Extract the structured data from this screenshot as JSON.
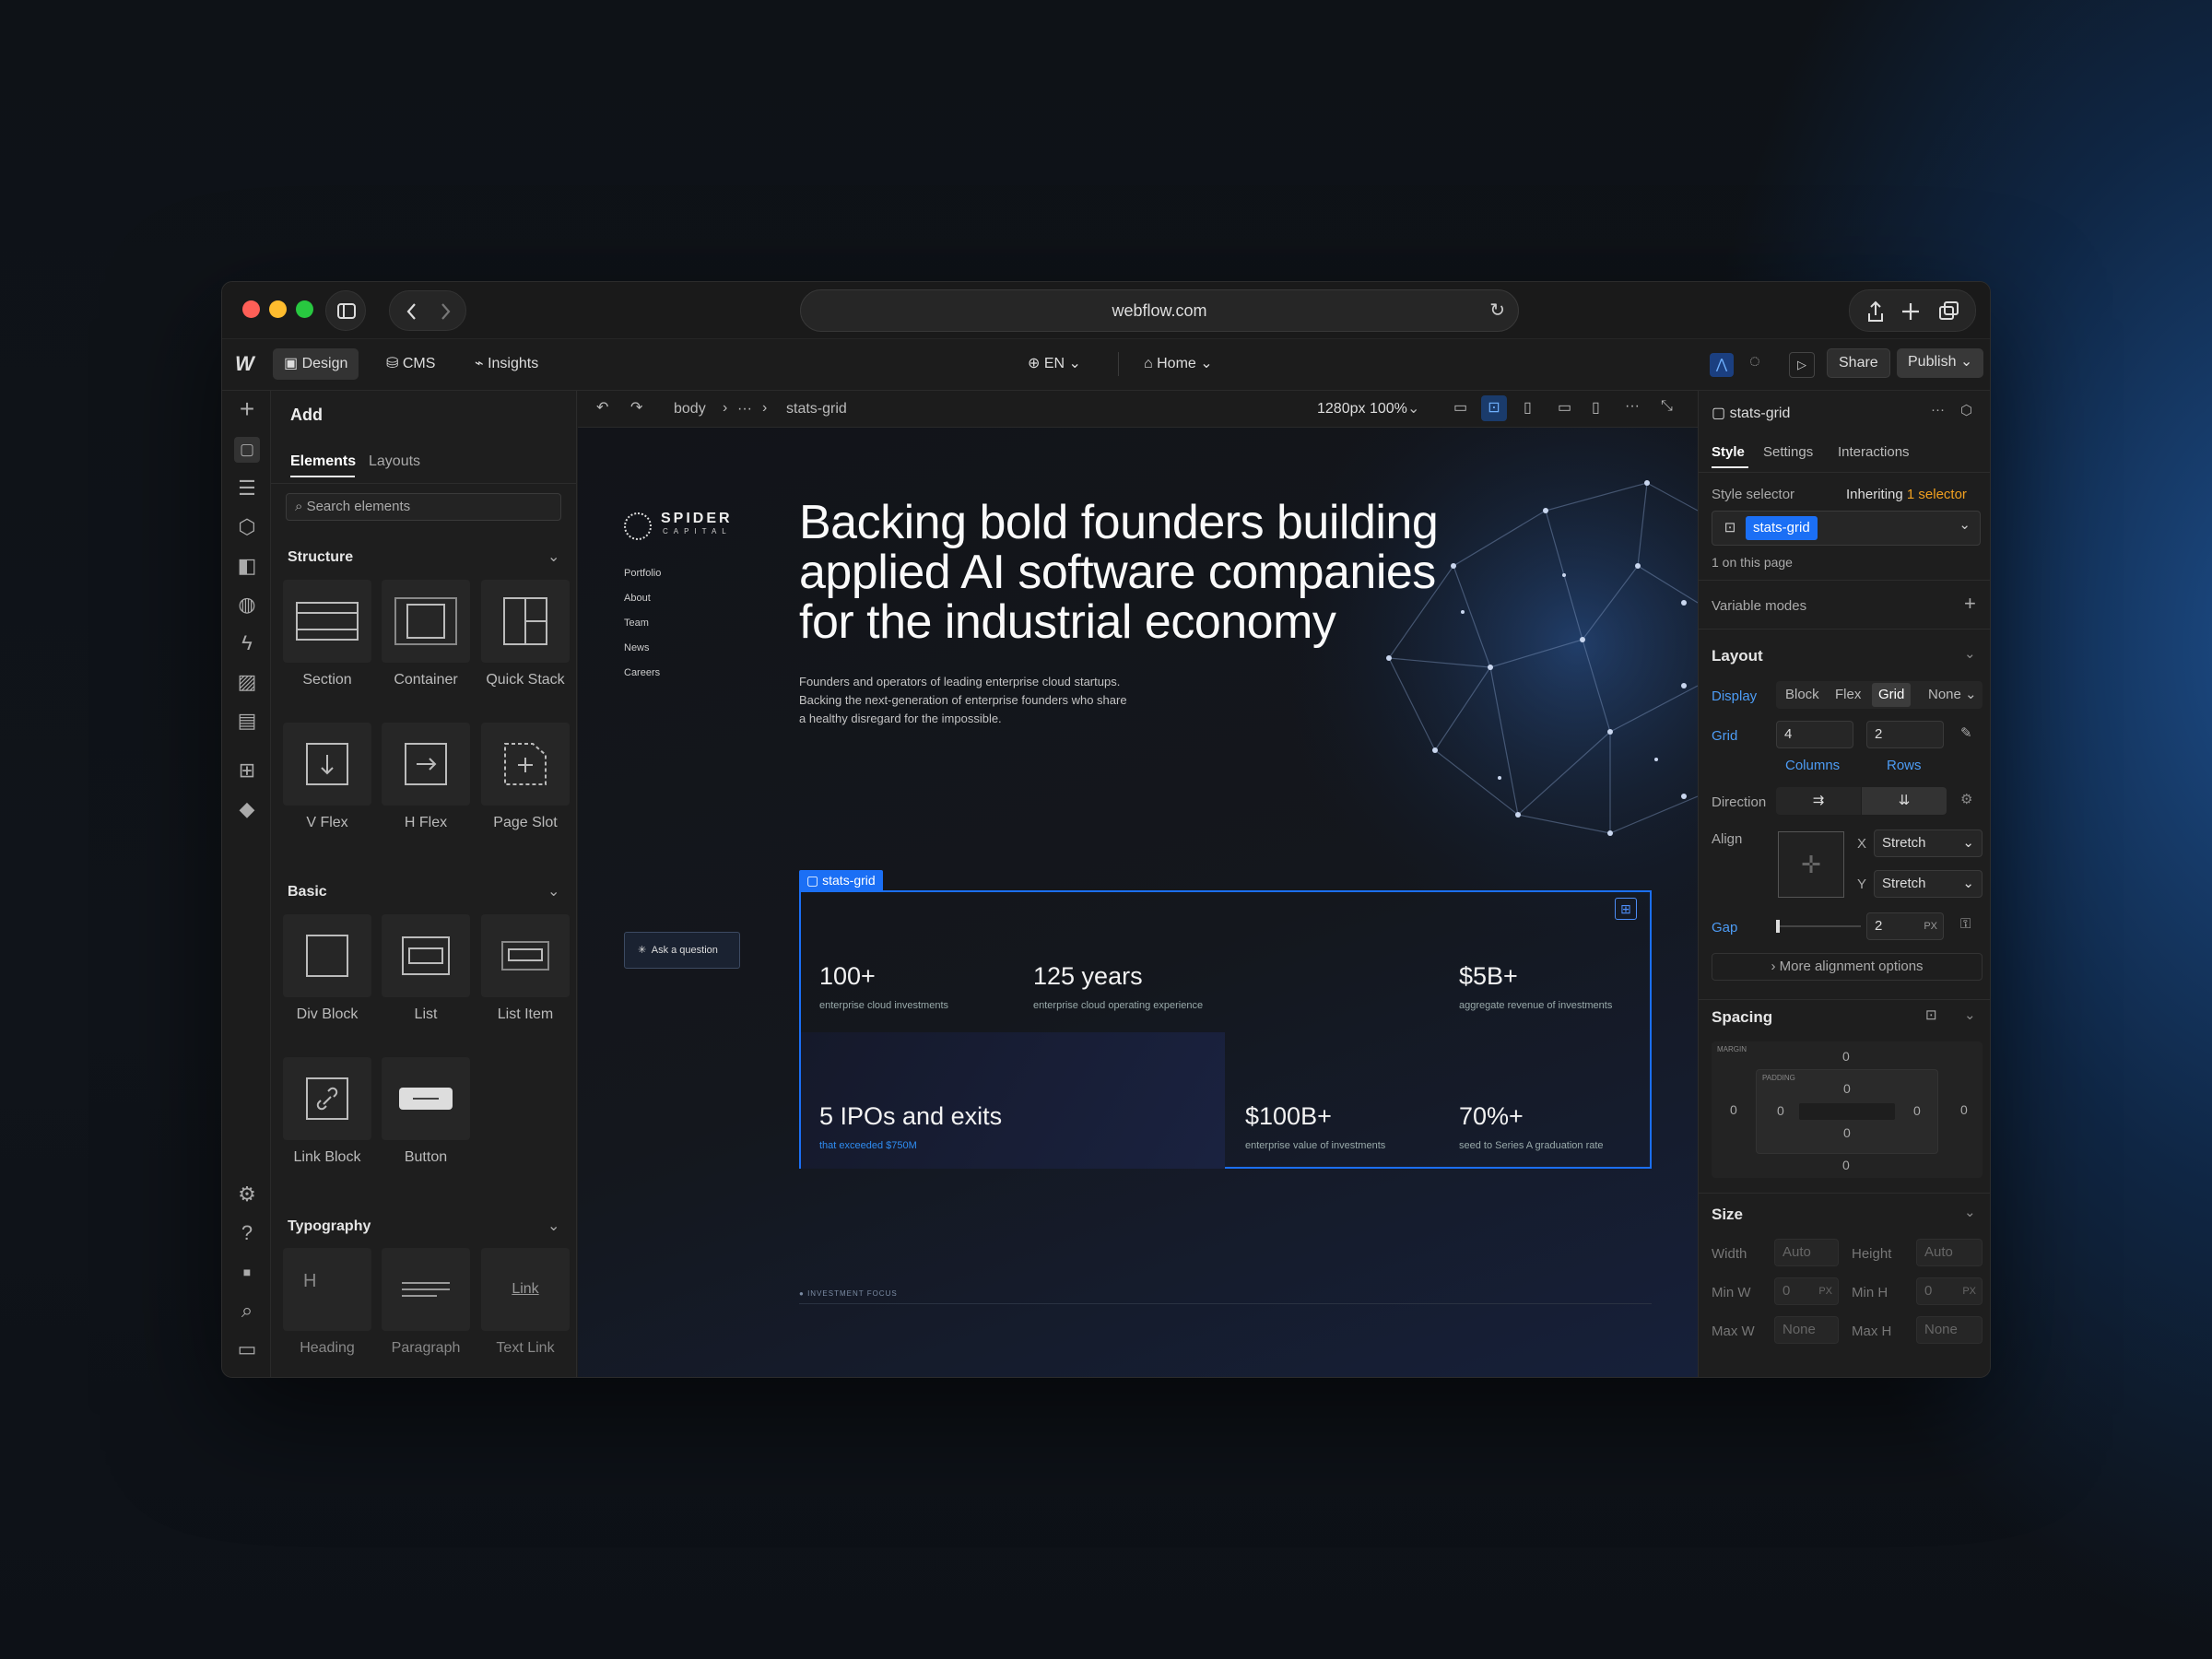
{
  "browser": {
    "url": "webflow.com"
  },
  "topbar": {
    "design": "Design",
    "cms": "CMS",
    "insights": "Insights",
    "lang": "EN",
    "page": "Home",
    "share": "Share",
    "publish": "Publish"
  },
  "add_panel": {
    "title": "Add",
    "tabs": [
      "Elements",
      "Layouts"
    ],
    "search_placeholder": "Search elements",
    "structure": {
      "title": "Structure",
      "items": [
        "Section",
        "Container",
        "Quick Stack",
        "V Flex",
        "H Flex",
        "Page Slot"
      ]
    },
    "basic": {
      "title": "Basic",
      "items": [
        "Div Block",
        "List",
        "List Item",
        "Link Block",
        "Button"
      ]
    },
    "typography": {
      "title": "Typography",
      "items": [
        "Heading",
        "Paragraph",
        "Text Link"
      ],
      "heading_glyph": "H",
      "link_glyph": "Link"
    }
  },
  "canvas_bar": {
    "crumb_body": "body",
    "crumb_more": "···",
    "crumb_current": "stats-grid",
    "viewport": "1280px 100%"
  },
  "site": {
    "logo_top": "SPIDER",
    "logo_bottom": "CAPITAL",
    "nav": [
      "Portfolio",
      "About",
      "Team",
      "News",
      "Careers"
    ],
    "headline": [
      "Backing bold founders building",
      "applied AI software companies",
      "for the industrial economy"
    ],
    "sub": [
      "Founders and operators of leading enterprise cloud startups.",
      "Backing the next-generation of enterprise founders who share",
      "a healthy disregard for the impossible."
    ],
    "ask": "Ask a question",
    "grid_tag": "stats-grid",
    "stats": [
      {
        "n": "100+",
        "c": "enterprise cloud investments"
      },
      {
        "n": "125 years",
        "c": "enterprise cloud operating experience"
      },
      {
        "n": "$5B+",
        "c": "aggregate revenue of investments"
      },
      {
        "n": "5 IPOs and exits",
        "c": "that exceeded $750M"
      },
      {
        "n": "$100B+",
        "c": "enterprise value of investments"
      },
      {
        "n": "70%+",
        "c": "seed to Series A graduation rate"
      }
    ],
    "focus": "INVESTMENT FOCUS"
  },
  "right_panel": {
    "element": "stats-grid",
    "tabs": [
      "Style",
      "Settings",
      "Interactions"
    ],
    "style_selector": "Style selector",
    "inheriting": "Inheriting",
    "inherit_count": "1 selector",
    "selector_chip": "stats-grid",
    "on_page": "1 on this page",
    "variable_modes": "Variable modes",
    "layout": {
      "title": "Layout",
      "display": "Display",
      "display_opts": [
        "Block",
        "Flex",
        "Grid",
        "None"
      ],
      "grid": "Grid",
      "cols": "4",
      "rows": "2",
      "cols_lbl": "Columns",
      "rows_lbl": "Rows",
      "direction": "Direction",
      "align": "Align",
      "x": "X",
      "y": "Y",
      "x_val": "Stretch",
      "y_val": "Stretch",
      "gap": "Gap",
      "gap_val": "2",
      "gap_unit": "PX",
      "more": "More alignment options"
    },
    "spacing": {
      "title": "Spacing",
      "margin": "MARGIN",
      "padding": "PADDING",
      "zero": "0"
    },
    "size": {
      "title": "Size",
      "width": "Width",
      "height": "Height",
      "auto": "Auto",
      "minw": "Min W",
      "minh": "Min H",
      "maxw": "Max W",
      "maxh": "Max H",
      "none": "None",
      "px": "PX"
    }
  },
  "colors": {
    "accent": "#1b6ff5"
  }
}
